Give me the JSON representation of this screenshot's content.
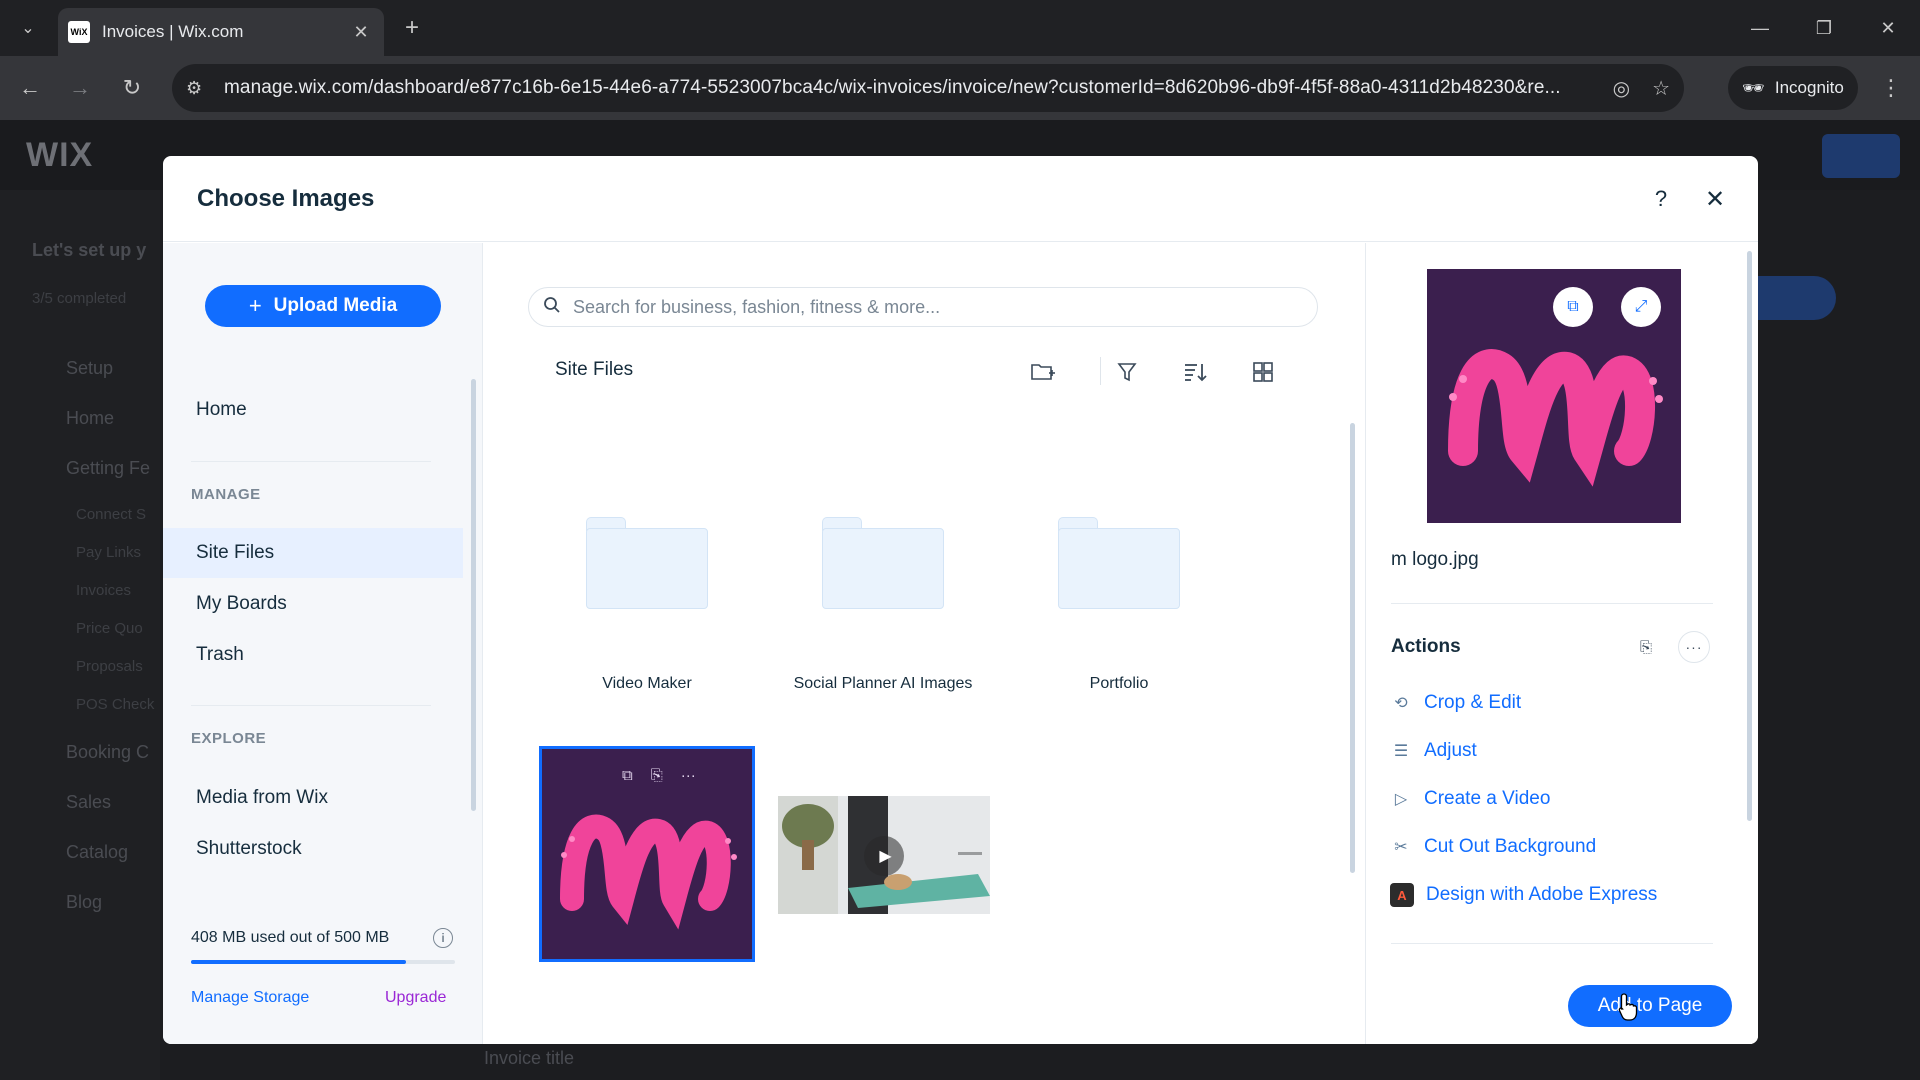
{
  "browser": {
    "tab_title": "Invoices | Wix.com",
    "favicon_text": "WiX",
    "url": "manage.wix.com/dashboard/e877c16b-6e15-44e6-a774-5523007bca4c/wix-invoices/invoice/new?customerId=8d620b96-db9f-4f5f-88a0-4311d2b48230&re...",
    "incognito_label": "Incognito"
  },
  "dashboard_bg": {
    "logo": "WIX",
    "setup_text": "Let's set up y",
    "progress_text": "3/5 completed",
    "nav": [
      "Setup",
      "Home",
      "Getting Fe",
      "Booking C",
      "Sales",
      "Catalog",
      "Blog"
    ],
    "subnav": [
      "Connect S",
      "Pay Links",
      "Invoices",
      "Price Quo",
      "Proposals",
      "POS Check"
    ],
    "bottom_text": "Invoice title"
  },
  "modal": {
    "title": "Choose Images",
    "upload_label": "Upload Media",
    "nav_home": "Home",
    "section_manage": "MANAGE",
    "nav_site_files": "Site Files",
    "nav_my_boards": "My Boards",
    "nav_trash": "Trash",
    "section_explore": "EXPLORE",
    "nav_media_from_wix": "Media from Wix",
    "nav_shutterstock": "Shutterstock",
    "storage_text": "408 MB used out of 500 MB",
    "storage_used_mb": 408,
    "storage_total_mb": 500,
    "manage_storage": "Manage Storage",
    "upgrade": "Upgrade",
    "search_placeholder": "Search for business, fashion, fitness & more...",
    "breadcrumb": "Site Files",
    "folders": [
      {
        "name": "Video Maker"
      },
      {
        "name": "Social Planner AI Images"
      },
      {
        "name": "Portfolio"
      }
    ],
    "selected_file_name": "m logo.jpg",
    "actions_title": "Actions",
    "actions": [
      {
        "label": "Crop & Edit",
        "icon": "crop-icon"
      },
      {
        "label": "Adjust",
        "icon": "sliders-icon"
      },
      {
        "label": "Create a Video",
        "icon": "video-icon"
      },
      {
        "label": "Cut Out Background",
        "icon": "scissors-icon"
      },
      {
        "label": "Design with Adobe Express",
        "icon": "adobe-express-icon"
      }
    ],
    "add_button": "Add to Page"
  },
  "colors": {
    "accent": "#116dff",
    "logo_bg": "#3b1f4e",
    "logo_pink": "#f0449a",
    "upgrade": "#9a27d5"
  }
}
